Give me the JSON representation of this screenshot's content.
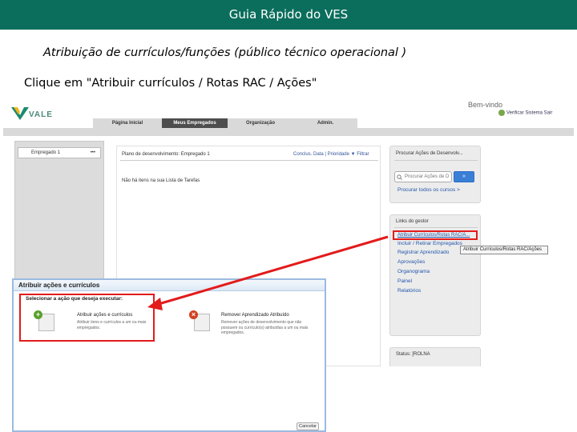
{
  "slide": {
    "header": "Guia Rápido do VES",
    "subtitle": "Atribuição de currículos/funções (público técnico operacional )",
    "instruction": "Clique em \"Atribuir currículos  / Rotas RAC / Ações\""
  },
  "app": {
    "brand": "VALE",
    "welcome": "Bem-vindo",
    "top_links": "Verificar Sistema   Sair",
    "nav_tabs": [
      "Página Inicial",
      "Meus Empregados",
      "Organização",
      "Admin."
    ],
    "employee_selector": "Empregado 1",
    "employee_selector_more": "•••",
    "plan": {
      "title": "Plano de desenvolvimento:  Empregado 1",
      "links": "Conclus.    Data  | Prioridade    ▼ Filtrar",
      "empty_message": "Não há itens na sua Lista de Tarefas"
    },
    "search_panel": {
      "title": "Procurar Ações de Desenvolv...",
      "placeholder": "Procurar Ações de D",
      "button": "»",
      "all_courses_link": "Procurar todos os cursos >"
    },
    "manager_links": {
      "title": "Links do gestor",
      "items": [
        "Atribuir Currículos/Rotas RAC/A...",
        "Incluir / Retirar Empregados",
        "Registrar Aprendizado",
        "Aprovações",
        "Organograma",
        "Painel",
        "Relatórios"
      ],
      "tooltip": "Atribuir Currículos/Rotas RAC/Ações"
    },
    "status_panel": {
      "title": "Status: [ROLNA"
    }
  },
  "dialog": {
    "title": "Atribuir ações e currículos",
    "prompt": "Selecionar a ação que deseja executar:",
    "options": [
      {
        "title": "Atribuir ações e currículos",
        "desc": "Atribuir itens e currículos a um ou mais empregados."
      },
      {
        "title": "Remover Aprendizado Atribuído",
        "desc": "Remover ações de desenvolvimento que não possuem ou currículo(s) atribuídas a um ou mais empregados."
      }
    ],
    "cancel": "Cancelar"
  },
  "colors": {
    "header_bg": "#0b6e5c",
    "highlight": "#e31b1b",
    "dialog_border": "#9bbbe0",
    "link": "#2255aa"
  }
}
